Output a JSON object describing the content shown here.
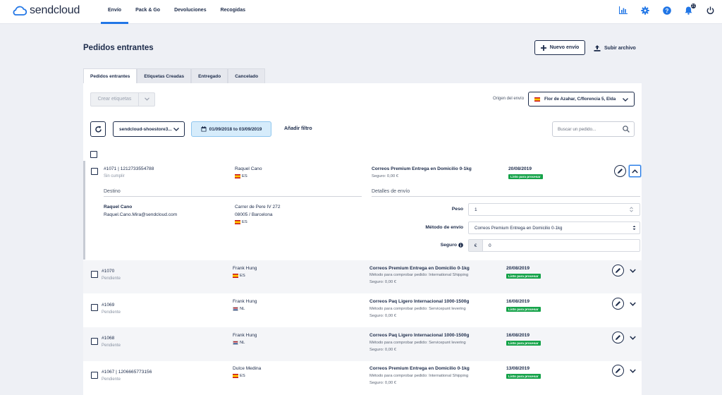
{
  "brand": {
    "name": "sendcloud"
  },
  "nav": {
    "items": [
      "Envío",
      "Pack & Go",
      "Devoluciones",
      "Recogidas"
    ]
  },
  "topbar": {
    "notifications_count": "21"
  },
  "page": {
    "title": "Pedidos entrantes",
    "new_shipment": "Nuevo envío",
    "upload_file": "Subir archivo"
  },
  "tabs": [
    "Pedidos entrantes",
    "Etiquetas Creadas",
    "Entregado",
    "Cancelado"
  ],
  "toolbar": {
    "create_labels": "Crear etiquetas",
    "origin_label": "Origen del envío",
    "origin_value": "Flor de Azahar, C/florencia 5, Elda",
    "store": "sendcloud-shoestore3...",
    "date_range": "01/09/2018 to 03/09/2019",
    "add_filter": "Añadir filtro",
    "search_placeholder": "Buscar un pedido..."
  },
  "orders": [
    {
      "number": "#1071 | 1212733554788",
      "status": "Sin cumplir",
      "name": "Raquel Cano",
      "country": "ES",
      "method": "Correos Premium Entrega en Domicilio 0-1kg",
      "line2": "",
      "insurance": "Seguro: 0,00 €",
      "date": "20/08/2019",
      "badge": "Listo para procesar"
    },
    {
      "number": "#1070",
      "status": "Pendiente",
      "name": "Frank Hung",
      "country": "ES",
      "method": "Correos Premium Entrega en Domicilio 0-1kg",
      "line2": "Método para comprobar pedido: International Shipping",
      "insurance": "Seguro: 0,00 €",
      "date": "20/08/2019",
      "badge": "Listo para procesar"
    },
    {
      "number": "#1069",
      "status": "Pendiente",
      "name": "Frank Hung",
      "country": "NL",
      "method": "Correos Paq Ligero Internacional 1000-1500g",
      "line2": "Método para comprobar pedido: Servicepunt levering",
      "insurance": "Seguro: 0,00 €",
      "date": "16/08/2019",
      "badge": "Listo para procesar"
    },
    {
      "number": "#1068",
      "status": "Pendiente",
      "name": "Frank Hung",
      "country": "NL",
      "method": "Correos Paq Ligero Internacional 1000-1500g",
      "line2": "Método para comprobar pedido: Servicepunt levering",
      "insurance": "Seguro: 0,00 €",
      "date": "16/08/2019",
      "badge": "Listo para procesar"
    },
    {
      "number": "#1067 | 1206665773156",
      "status": "Pendiente",
      "name": "Dulce Medina",
      "country": "ES",
      "method": "Correos Premium Entrega en Domicilio 0-1kg",
      "line2": "Método para comprobar pedido: International Shipping",
      "insurance": "Seguro: 0,00 €",
      "date": "13/08/2019",
      "badge": "Listo para procesar"
    }
  ],
  "details": {
    "destination_title": "Destino",
    "shipping_title": "Detalles de envío",
    "recipient_name": "Raquel Cano",
    "recipient_email": "Raquel.Cano.Mira@sendcloud.com",
    "address1": "Carrer de Pere IV 272",
    "address2": "08005 / Barcelona",
    "country": "ES",
    "weight_label": "Peso",
    "weight_value": "1",
    "method_label": "Método de envío",
    "method_value": "Correos Premium Entrega en Domicilio 0-1kg",
    "insurance_label": "Seguro",
    "currency": "€",
    "insurance_value": "0"
  },
  "colors": {
    "accent": "#2176e6",
    "navy": "#1c2b4a",
    "success": "#16a34a"
  }
}
